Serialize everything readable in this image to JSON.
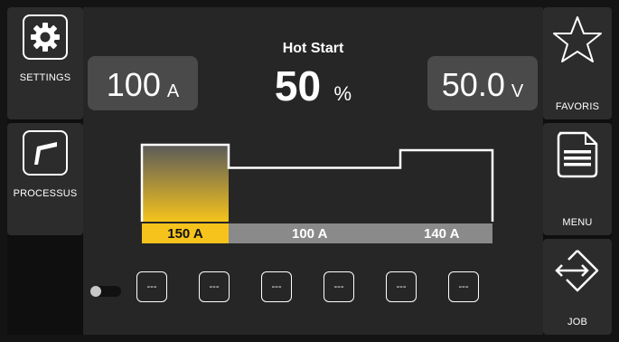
{
  "sidebar_left": {
    "settings_label": "SETTINGS",
    "process_label": "PROCESSUS"
  },
  "sidebar_right": {
    "favorites_label": "FAVORIS",
    "menu_label": "MENU",
    "job_label": "JOB"
  },
  "main": {
    "title": "Hot Start",
    "value": "50",
    "value_unit": "%",
    "current_box": {
      "value": "100",
      "unit": "A"
    },
    "voltage_box": {
      "value": "50.0",
      "unit": "V"
    },
    "segments": [
      {
        "label": "150 A",
        "level": 1.0
      },
      {
        "label": "100 A",
        "level": 0.7
      },
      {
        "label": "140 A",
        "level": 0.93
      }
    ],
    "presets": [
      "---",
      "---",
      "---",
      "---",
      "---",
      "---"
    ]
  },
  "colors": {
    "accent": "#f5c31c",
    "segment_grey": "#8a8a8a",
    "box": "#4a4a4a"
  }
}
